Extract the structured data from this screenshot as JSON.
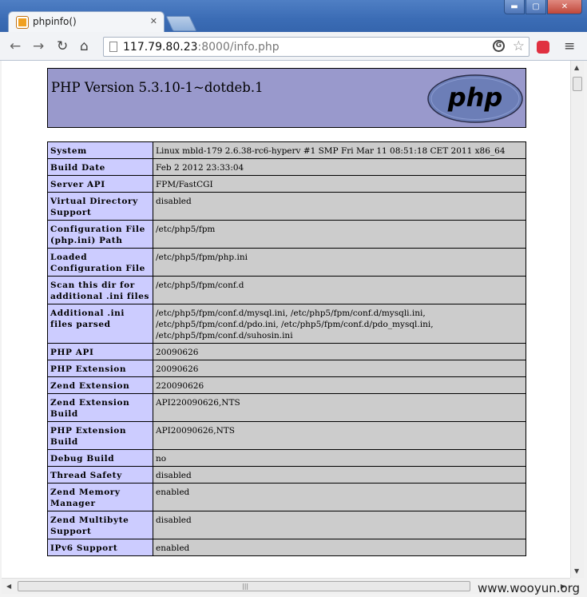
{
  "browser": {
    "tab_title": "phpinfo()",
    "url_host": "117.79.80.23",
    "url_rest": ":8000/info.php"
  },
  "window_controls": {
    "minimize": "▬",
    "maximize": "▢",
    "close": "✕"
  },
  "php": {
    "version_title": "PHP Version 5.3.10-1~dotdeb.1",
    "logo_text": "php"
  },
  "rows": [
    {
      "name": "System",
      "value": "Linux mbld-179 2.6.38-rc6-hyperv #1 SMP Fri Mar 11 08:51:18 CET 2011 x86_64"
    },
    {
      "name": "Build Date",
      "value": "Feb 2 2012 23:33:04"
    },
    {
      "name": "Server API",
      "value": "FPM/FastCGI"
    },
    {
      "name": "Virtual Directory Support",
      "value": "disabled"
    },
    {
      "name": "Configuration File (php.ini) Path",
      "value": "/etc/php5/fpm"
    },
    {
      "name": "Loaded Configuration File",
      "value": "/etc/php5/fpm/php.ini"
    },
    {
      "name": "Scan this dir for additional .ini files",
      "value": "/etc/php5/fpm/conf.d"
    },
    {
      "name": "Additional .ini files parsed",
      "value": "/etc/php5/fpm/conf.d/mysql.ini, /etc/php5/fpm/conf.d/mysqli.ini, /etc/php5/fpm/conf.d/pdo.ini, /etc/php5/fpm/conf.d/pdo_mysql.ini, /etc/php5/fpm/conf.d/suhosin.ini"
    },
    {
      "name": "PHP API",
      "value": "20090626"
    },
    {
      "name": "PHP Extension",
      "value": "20090626"
    },
    {
      "name": "Zend Extension",
      "value": "220090626"
    },
    {
      "name": "Zend Extension Build",
      "value": "API220090626,NTS"
    },
    {
      "name": "PHP Extension Build",
      "value": "API20090626,NTS"
    },
    {
      "name": "Debug Build",
      "value": "no"
    },
    {
      "name": "Thread Safety",
      "value": "disabled"
    },
    {
      "name": "Zend Memory Manager",
      "value": "enabled"
    },
    {
      "name": "Zend Multibyte Support",
      "value": "disabled"
    },
    {
      "name": "IPv6 Support",
      "value": "enabled"
    }
  ],
  "watermark": "www.wooyun.org"
}
